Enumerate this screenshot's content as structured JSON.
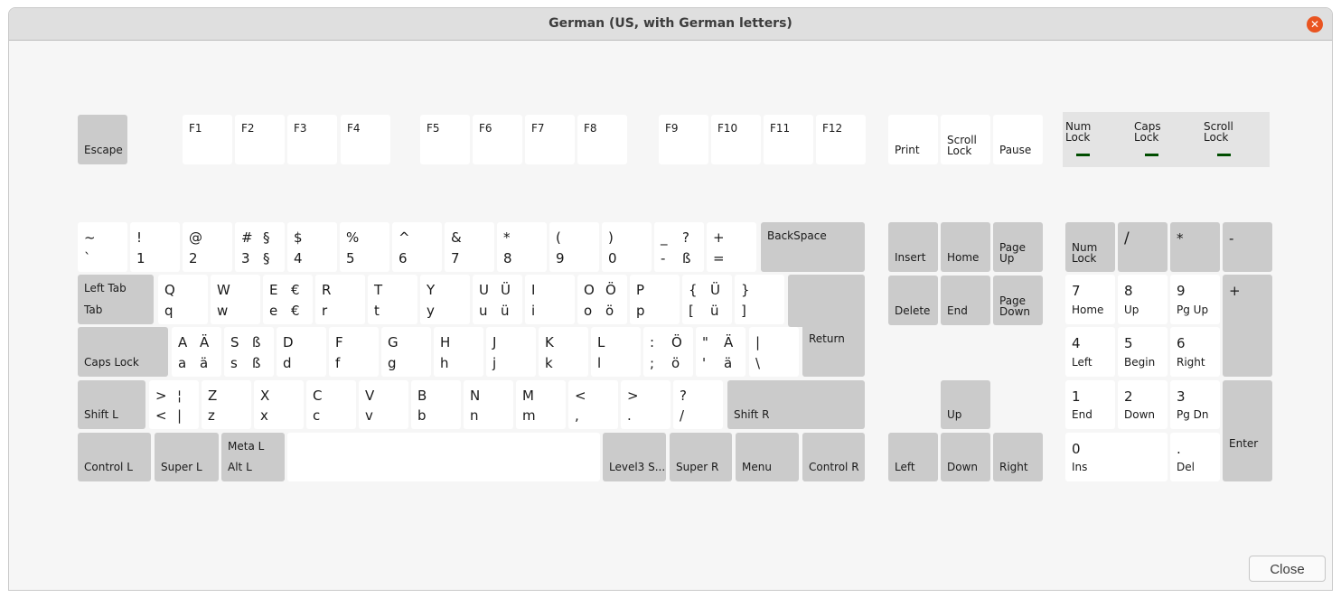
{
  "window": {
    "title": "German (US, with German letters)",
    "close_icon": "close-icon",
    "close_button": "Close"
  },
  "colors": {
    "close_icon_bg": "#e95420",
    "led_on": "#004d00",
    "key_modifier": "#cbcbcb",
    "key_char": "#ffffff"
  },
  "function_row": {
    "escape": "Escape",
    "f": [
      "F1",
      "F2",
      "F3",
      "F4",
      "F5",
      "F6",
      "F7",
      "F8",
      "F9",
      "F10",
      "F11",
      "F12"
    ],
    "print": "Print",
    "scroll_lock": "Scroll\nLock",
    "pause": "Pause"
  },
  "leds": [
    {
      "label": "Num\nLock",
      "state": "on"
    },
    {
      "label": "Caps\nLock",
      "state": "on"
    },
    {
      "label": "Scroll\nLock",
      "state": "on"
    }
  ],
  "rows": {
    "number": [
      {
        "tl": "~",
        "bl": "`",
        "tr": "",
        "br": ""
      },
      {
        "tl": "!",
        "bl": "1",
        "tr": "",
        "br": ""
      },
      {
        "tl": "@",
        "bl": "2",
        "tr": "",
        "br": ""
      },
      {
        "tl": "#",
        "bl": "3",
        "tr": "§",
        "br": "§"
      },
      {
        "tl": "$",
        "bl": "4",
        "tr": "",
        "br": ""
      },
      {
        "tl": "%",
        "bl": "5",
        "tr": "",
        "br": ""
      },
      {
        "tl": "^",
        "bl": "6",
        "tr": "",
        "br": ""
      },
      {
        "tl": "&",
        "bl": "7",
        "tr": "",
        "br": ""
      },
      {
        "tl": "*",
        "bl": "8",
        "tr": "",
        "br": ""
      },
      {
        "tl": "(",
        "bl": "9",
        "tr": "",
        "br": ""
      },
      {
        "tl": ")",
        "bl": "0",
        "tr": "",
        "br": ""
      },
      {
        "tl": "_",
        "bl": "-",
        "tr": "?",
        "br": "ß"
      },
      {
        "tl": "+",
        "bl": "=",
        "tr": "",
        "br": ""
      }
    ],
    "backspace": "BackSpace",
    "qwerty_tab_top": "Left Tab",
    "qwerty_tab_bottom": "Tab",
    "qwerty": [
      {
        "tl": "Q",
        "bl": "q",
        "tr": "",
        "br": ""
      },
      {
        "tl": "W",
        "bl": "w",
        "tr": "",
        "br": ""
      },
      {
        "tl": "E",
        "bl": "e",
        "tr": "€",
        "br": "€"
      },
      {
        "tl": "R",
        "bl": "r",
        "tr": "",
        "br": ""
      },
      {
        "tl": "T",
        "bl": "t",
        "tr": "",
        "br": ""
      },
      {
        "tl": "Y",
        "bl": "y",
        "tr": "",
        "br": ""
      },
      {
        "tl": "U",
        "bl": "u",
        "tr": "Ü",
        "br": "ü"
      },
      {
        "tl": "I",
        "bl": "i",
        "tr": "",
        "br": ""
      },
      {
        "tl": "O",
        "bl": "o",
        "tr": "Ö",
        "br": "ö"
      },
      {
        "tl": "P",
        "bl": "p",
        "tr": "",
        "br": ""
      },
      {
        "tl": "{",
        "bl": "[",
        "tr": "Ü",
        "br": "ü"
      },
      {
        "tl": "}",
        "bl": "]",
        "tr": "",
        "br": ""
      }
    ],
    "return": "Return",
    "caps_lock": "Caps Lock",
    "home": [
      {
        "tl": "A",
        "bl": "a",
        "tr": "Ä",
        "br": "ä"
      },
      {
        "tl": "S",
        "bl": "s",
        "tr": "ß",
        "br": "ß"
      },
      {
        "tl": "D",
        "bl": "d",
        "tr": "",
        "br": ""
      },
      {
        "tl": "F",
        "bl": "f",
        "tr": "",
        "br": ""
      },
      {
        "tl": "G",
        "bl": "g",
        "tr": "",
        "br": ""
      },
      {
        "tl": "H",
        "bl": "h",
        "tr": "",
        "br": ""
      },
      {
        "tl": "J",
        "bl": "j",
        "tr": "",
        "br": ""
      },
      {
        "tl": "K",
        "bl": "k",
        "tr": "",
        "br": ""
      },
      {
        "tl": "L",
        "bl": "l",
        "tr": "",
        "br": ""
      },
      {
        "tl": ":",
        "bl": ";",
        "tr": "Ö",
        "br": "ö"
      },
      {
        "tl": "\"",
        "bl": "'",
        "tr": "Ä",
        "br": "ä"
      },
      {
        "tl": "|",
        "bl": "\\",
        "tr": "",
        "br": ""
      }
    ],
    "shift_l": "Shift L",
    "bottom": [
      {
        "tl": ">",
        "bl": "<",
        "tr": "¦",
        "br": "|"
      },
      {
        "tl": "Z",
        "bl": "z",
        "tr": "",
        "br": ""
      },
      {
        "tl": "X",
        "bl": "x",
        "tr": "",
        "br": ""
      },
      {
        "tl": "C",
        "bl": "c",
        "tr": "",
        "br": ""
      },
      {
        "tl": "V",
        "bl": "v",
        "tr": "",
        "br": ""
      },
      {
        "tl": "B",
        "bl": "b",
        "tr": "",
        "br": ""
      },
      {
        "tl": "N",
        "bl": "n",
        "tr": "",
        "br": ""
      },
      {
        "tl": "M",
        "bl": "m",
        "tr": "",
        "br": ""
      },
      {
        "tl": "<",
        "bl": ",",
        "tr": "",
        "br": ""
      },
      {
        "tl": ">",
        "bl": ".",
        "tr": "",
        "br": ""
      },
      {
        "tl": "?",
        "bl": "/",
        "tr": "",
        "br": ""
      }
    ],
    "shift_r": "Shift R",
    "space_row": {
      "control_l": "Control L",
      "super_l": "Super L",
      "meta_l": "Meta L",
      "alt_l": "Alt L",
      "space": "",
      "level3": "Level3 S...",
      "super_r": "Super R",
      "menu": "Menu",
      "control_r": "Control R"
    }
  },
  "nav": {
    "insert": "Insert",
    "home": "Home",
    "page_up": "Page\nUp",
    "delete": "Delete",
    "end": "End",
    "page_down": "Page\nDown",
    "up": "Up",
    "left": "Left",
    "down": "Down",
    "right": "Right"
  },
  "numpad": {
    "num_lock": "Num\nLock",
    "divide": "/",
    "multiply": "*",
    "minus": "-",
    "plus": "+",
    "enter": "Enter",
    "keys": [
      {
        "top": "7",
        "bottom": "Home"
      },
      {
        "top": "8",
        "bottom": "Up"
      },
      {
        "top": "9",
        "bottom": "Pg Up"
      },
      {
        "top": "4",
        "bottom": "Left"
      },
      {
        "top": "5",
        "bottom": "Begin"
      },
      {
        "top": "6",
        "bottom": "Right"
      },
      {
        "top": "1",
        "bottom": "End"
      },
      {
        "top": "2",
        "bottom": "Down"
      },
      {
        "top": "3",
        "bottom": "Pg Dn"
      },
      {
        "top": "0",
        "bottom": "Ins"
      },
      {
        "top": ".",
        "bottom": "Del"
      }
    ]
  }
}
